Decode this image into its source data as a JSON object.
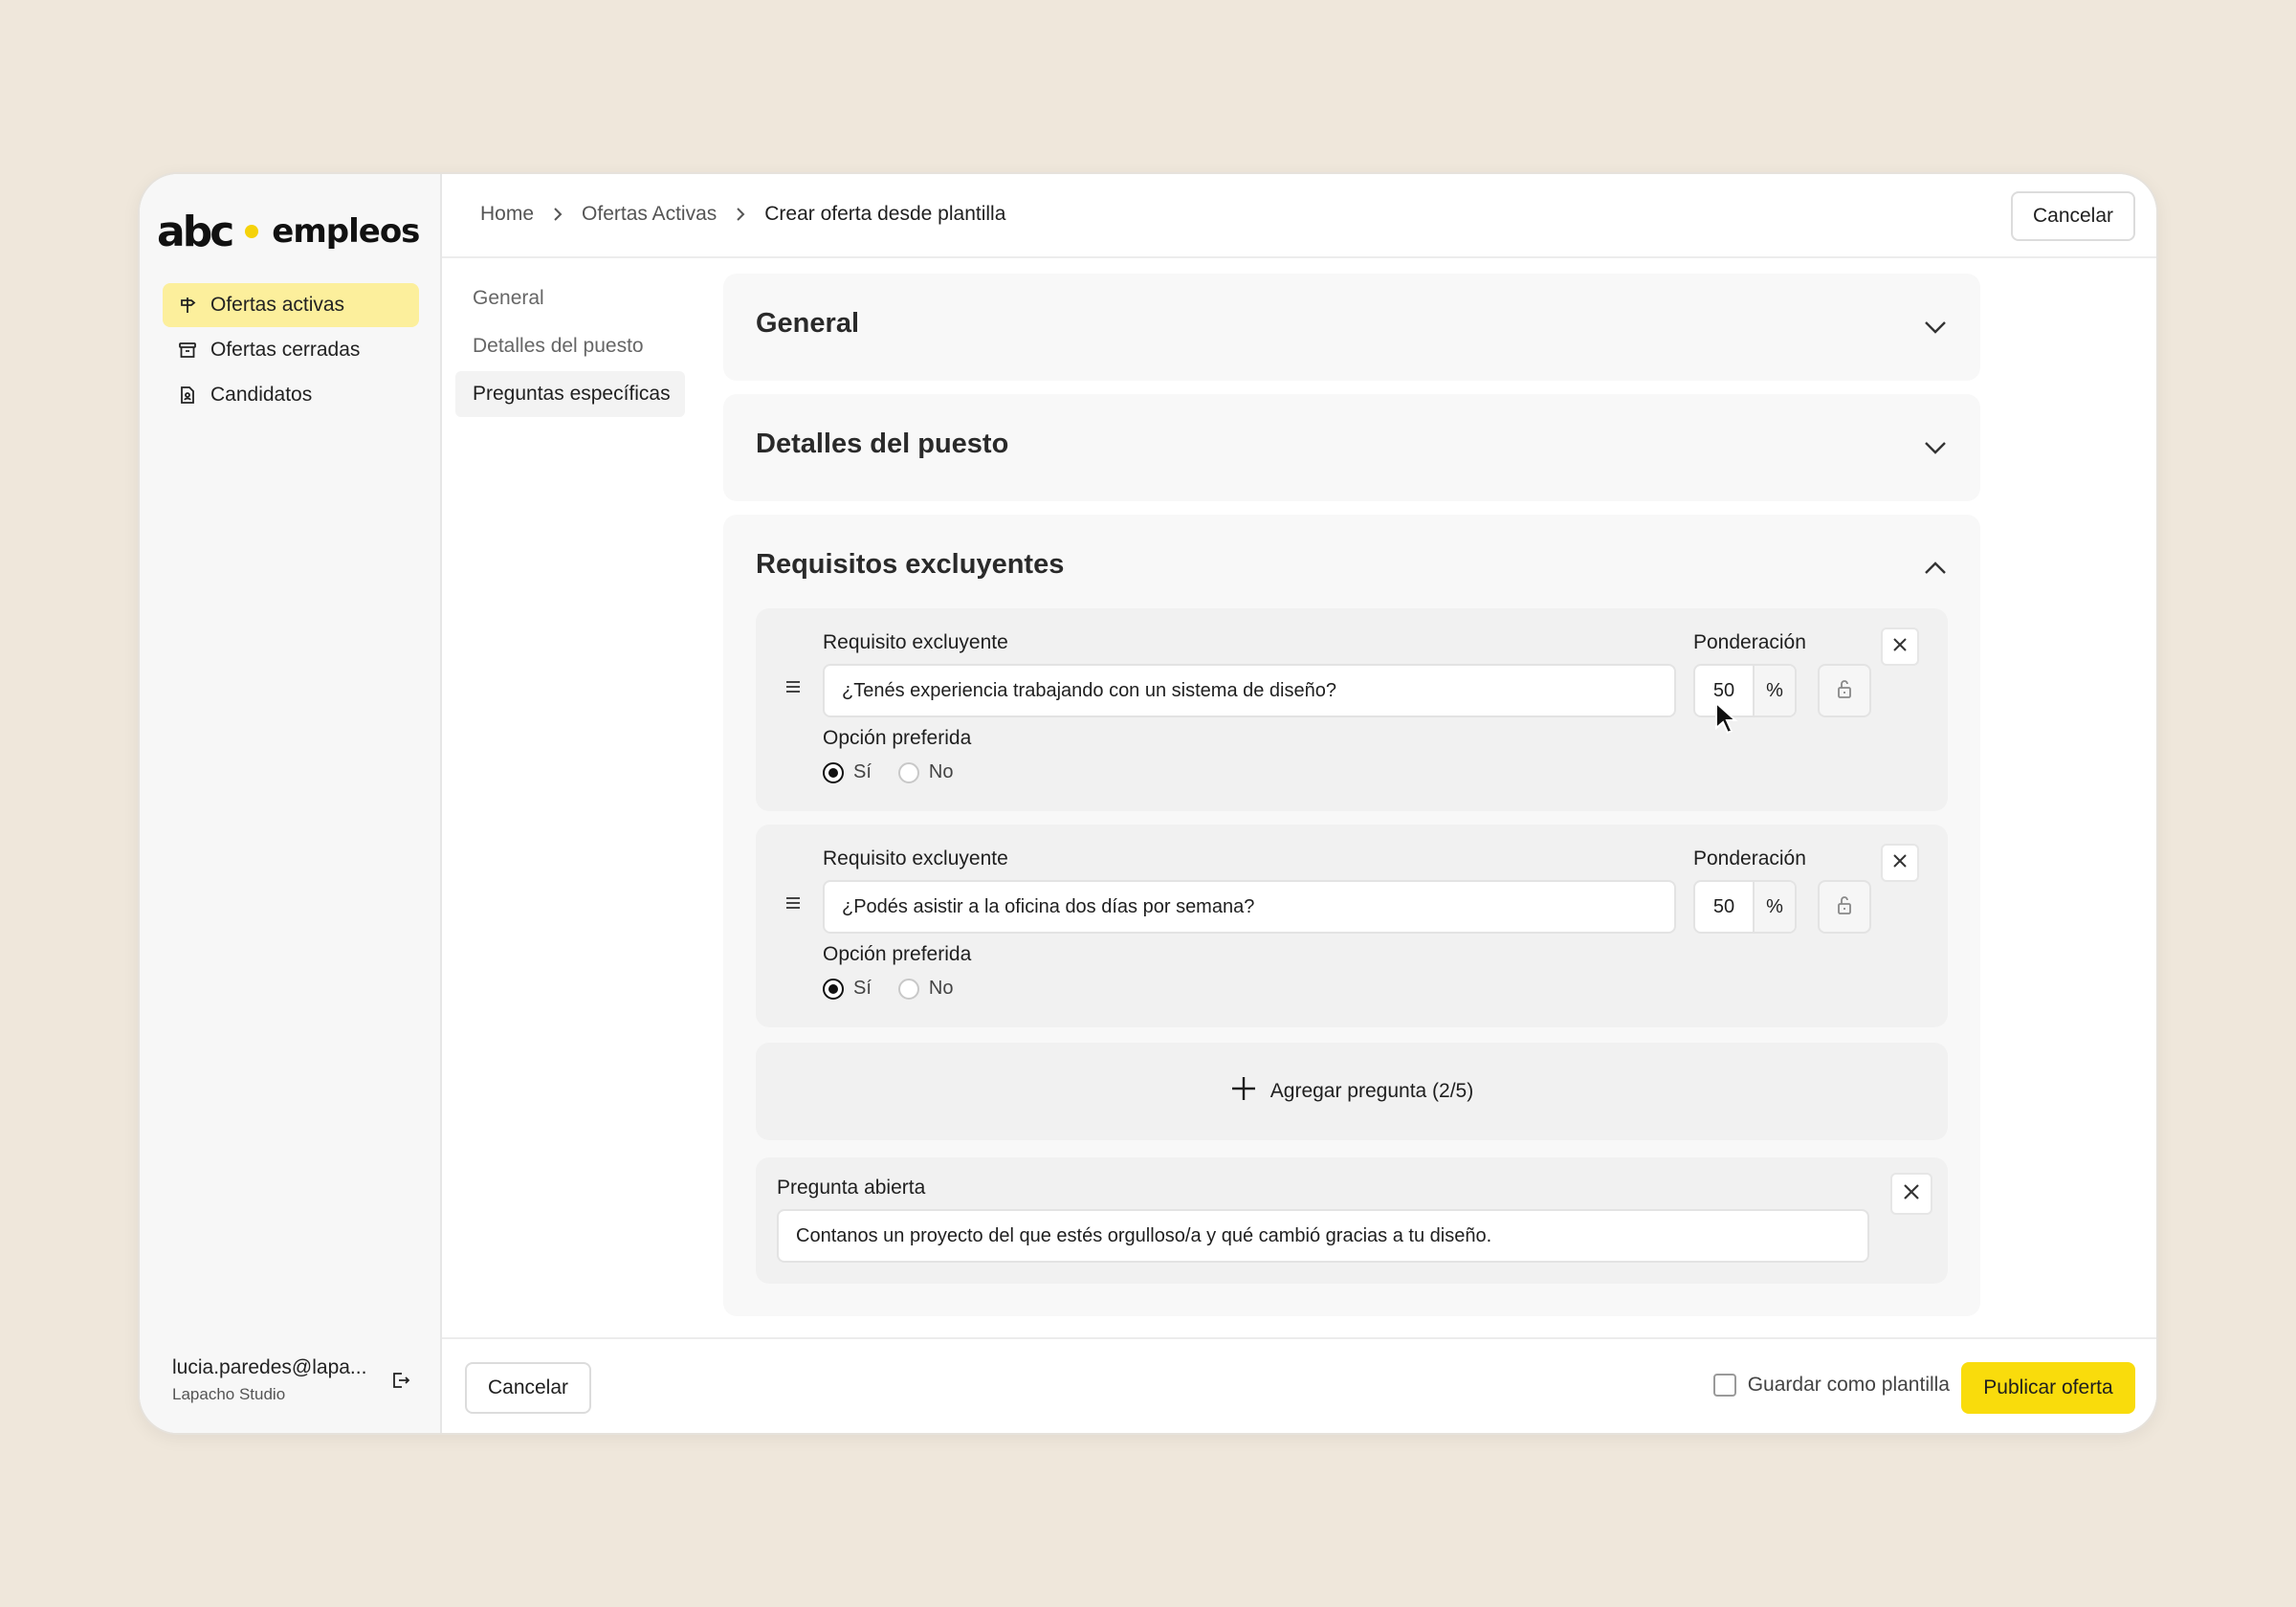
{
  "brand": {
    "logo_text_left": "abc",
    "logo_text_right": "empleos",
    "accent": "#f9dc0c"
  },
  "sidebar": {
    "items": [
      {
        "label": "Ofertas activas",
        "icon": "signpost-icon",
        "active": true
      },
      {
        "label": "Ofertas cerradas",
        "icon": "archive-icon",
        "active": false
      },
      {
        "label": "Candidatos",
        "icon": "document-user-icon",
        "active": false
      }
    ],
    "user": {
      "email": "lucia.paredes@lapa...",
      "org": "Lapacho Studio"
    }
  },
  "header": {
    "breadcrumb": [
      "Home",
      "Ofertas Activas",
      "Crear oferta desde plantilla"
    ],
    "cancel_label": "Cancelar"
  },
  "section_nav": [
    {
      "label": "General",
      "active": false
    },
    {
      "label": "Detalles del puesto",
      "active": false
    },
    {
      "label": "Preguntas específicas",
      "active": true
    }
  ],
  "main": {
    "accordions": [
      {
        "title": "General",
        "expanded": false
      },
      {
        "title": "Detalles del puesto",
        "expanded": false
      },
      {
        "title": "Requisitos excluyentes",
        "expanded": true
      }
    ],
    "requirements": [
      {
        "label": "Requisito excluyente",
        "value": "¿Tenés experiencia trabajando con un sistema de diseño?",
        "weight_label": "Ponderación",
        "weight": "50",
        "unit": "%",
        "preferred_label": "Opción preferida",
        "options": [
          "Sí",
          "No"
        ],
        "selected": "Sí"
      },
      {
        "label": "Requisito excluyente",
        "value": "¿Podés asistir a la oficina dos días por semana?",
        "weight_label": "Ponderación",
        "weight": "50",
        "unit": "%",
        "preferred_label": "Opción preferida",
        "options": [
          "Sí",
          "No"
        ],
        "selected": "Sí"
      }
    ],
    "add_question_label": "Agregar pregunta (2/5)",
    "open_question": {
      "label": "Pregunta abierta",
      "value": "Contanos un proyecto del que estés orgulloso/a y qué cambió gracias a tu diseño."
    }
  },
  "footer": {
    "cancel_label": "Cancelar",
    "save_template_label": "Guardar como plantilla",
    "publish_label": "Publicar oferta"
  }
}
